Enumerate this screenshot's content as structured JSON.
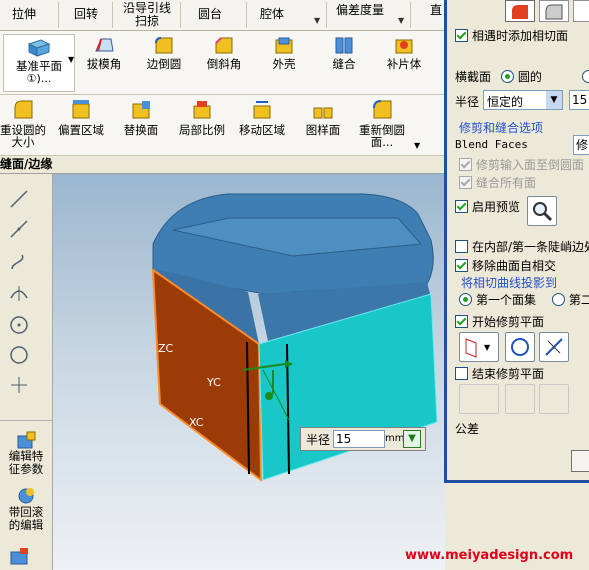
{
  "ribbon_row1": {
    "items": [
      "拉伸",
      "回转",
      "沿导引线扫掠",
      "圆台",
      "腔体",
      "偏差度量",
      "直"
    ]
  },
  "ribbon_row2": {
    "items": [
      "基准平面",
      "①)...",
      "拔模角",
      "边倒圆",
      "倒斜角",
      "外壳",
      "缝合",
      "补片体"
    ]
  },
  "ribbon_row3": {
    "items": [
      "重设圆的大小",
      "偏置区域",
      "替换面",
      "局部比例",
      "移动区域",
      "图样面",
      "重新倒圆面..."
    ]
  },
  "titlebar": {
    "text": "缝面/边缘"
  },
  "left_panel": {
    "edit_feature": "编辑特征参数",
    "edit_blend": "带回滚的编辑"
  },
  "dialog": {
    "add_tangent_face": "相遇时添加相切面",
    "cross_section_label": "横截面",
    "circle_option": "圆的",
    "radius_label": "半径",
    "radius_mode": "恒定的",
    "radius_value": "15",
    "trim_section": "修剪和缝合选项",
    "blend_faces_label": "Blend Faces",
    "blend_faces_value": "修",
    "trim_input_faces": "修剪输入面至倒圆面",
    "stitch_all_faces": "缝合所有面",
    "enable_preview": "启用预览",
    "inside_first_edge": "在内部/第一条陡峭边处",
    "remove_self_intersect": "移除曲面自相交",
    "project_tangent_curves": "将相切曲线投影到",
    "first_face_set": "第一个面集",
    "second_face_set": "第二",
    "start_trim_plane": "开始修剪平面",
    "end_trim_plane": "结束修剪平面",
    "tolerance": "公差"
  },
  "popup": {
    "label": "半径",
    "value": "15",
    "unit": "mm"
  },
  "axes": {
    "zc": "ZC",
    "yc": "YC",
    "xc": "XC"
  },
  "watermark": "www.meiyadesign.com"
}
